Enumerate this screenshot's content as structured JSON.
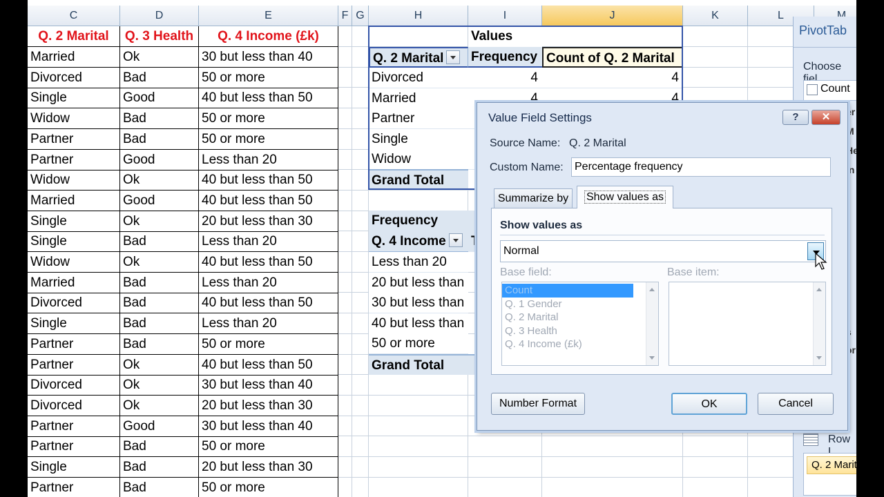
{
  "columns": [
    {
      "letter": "C"
    },
    {
      "letter": "D"
    },
    {
      "letter": "E"
    },
    {
      "letter": "F"
    },
    {
      "letter": "G"
    },
    {
      "letter": "H"
    },
    {
      "letter": "I"
    },
    {
      "letter": "J"
    },
    {
      "letter": "K"
    },
    {
      "letter": "L"
    },
    {
      "letter": "M"
    }
  ],
  "data_headers": {
    "c": "Q. 2 Marital",
    "d": "Q. 3 Health",
    "e": "Q. 4 Income (£k)"
  },
  "rows": [
    [
      "Married",
      "Ok",
      "30 but less than 40"
    ],
    [
      "Divorced",
      "Bad",
      "50 or more"
    ],
    [
      "Single",
      "Good",
      "40 but less than 50"
    ],
    [
      "Widow",
      "Bad",
      "50 or more"
    ],
    [
      "Partner",
      "Bad",
      "50 or more"
    ],
    [
      "Partner",
      "Good",
      "Less than 20"
    ],
    [
      "Widow",
      "Ok",
      "40 but less than 50"
    ],
    [
      "Married",
      "Good",
      "40 but less than 50"
    ],
    [
      "Single",
      "Ok",
      "20 but less than 30"
    ],
    [
      "Single",
      "Bad",
      "Less than 20"
    ],
    [
      "Widow",
      "Ok",
      "40 but less than 50"
    ],
    [
      "Married",
      "Bad",
      "Less than 20"
    ],
    [
      "Divorced",
      "Bad",
      "40 but less than 50"
    ],
    [
      "Single",
      "Bad",
      "Less than 20"
    ],
    [
      "Partner",
      "Bad",
      "50 or more"
    ],
    [
      "Partner",
      "Ok",
      "40 but less than 50"
    ],
    [
      "Divorced",
      "Ok",
      "30 but less than 40"
    ],
    [
      "Divorced",
      "Ok",
      "20 but less than 30"
    ],
    [
      "Partner",
      "Good",
      "30 but less than 40"
    ],
    [
      "Partner",
      "Bad",
      "50 or more"
    ],
    [
      "Single",
      "Bad",
      "20 but less than 30"
    ],
    [
      "Partner",
      "Bad",
      "50 or more"
    ]
  ],
  "pivot1": {
    "values_label": "Values",
    "row_label": "Q. 2 Marital",
    "col1": "Frequency",
    "col2": "Count of Q. 2 Marital",
    "rows": [
      {
        "label": "Divorced",
        "v1": "4",
        "v2": "4"
      },
      {
        "label": "Married",
        "v1": "4",
        "v2": "4"
      },
      {
        "label": "Partner"
      },
      {
        "label": "Single"
      },
      {
        "label": "Widow"
      }
    ],
    "total": "Grand Total"
  },
  "pivot2": {
    "values_label": "Frequency",
    "row_label": "Q. 4 Income",
    "extra": "T",
    "rows": [
      "Less than 20",
      "20 but less than",
      "30 but less than",
      "40 but less than",
      "50 or more"
    ],
    "total": "Grand Total"
  },
  "taskpane": {
    "title": "PivotTab",
    "choose": "Choose fiel",
    "count_field": "Count",
    "partials": [
      "er",
      "M",
      "He",
      "In"
    ],
    "partials2": [
      "s",
      "or"
    ],
    "row_labels": "Row L",
    "row_item": "Q. 2 Marit"
  },
  "dialog": {
    "title": "Value Field Settings",
    "help_btn": "?",
    "close_btn": "✕",
    "source_label": "Source Name:",
    "source_value": "Q. 2 Marital",
    "custom_label": "Custom Name:",
    "custom_value": "Percentage frequency",
    "tab1": "Summarize by",
    "tab2": "Show values as",
    "section_title": "Show values as",
    "dropdown_value": "Normal",
    "base_field_label": "Base field:",
    "base_item_label": "Base item:",
    "base_fields": [
      "Count",
      "Q. 1 Gender",
      "Q. 2 Marital",
      "Q. 3 Health",
      "Q. 4 Income (£k)"
    ],
    "number_format": "Number Format",
    "ok": "OK",
    "cancel": "Cancel"
  },
  "colors": {
    "header_red": "#e1141b",
    "pivot_blue": "#dce6f1",
    "dialog_bg": "#dfe8f5",
    "selection": "#3399ff"
  }
}
